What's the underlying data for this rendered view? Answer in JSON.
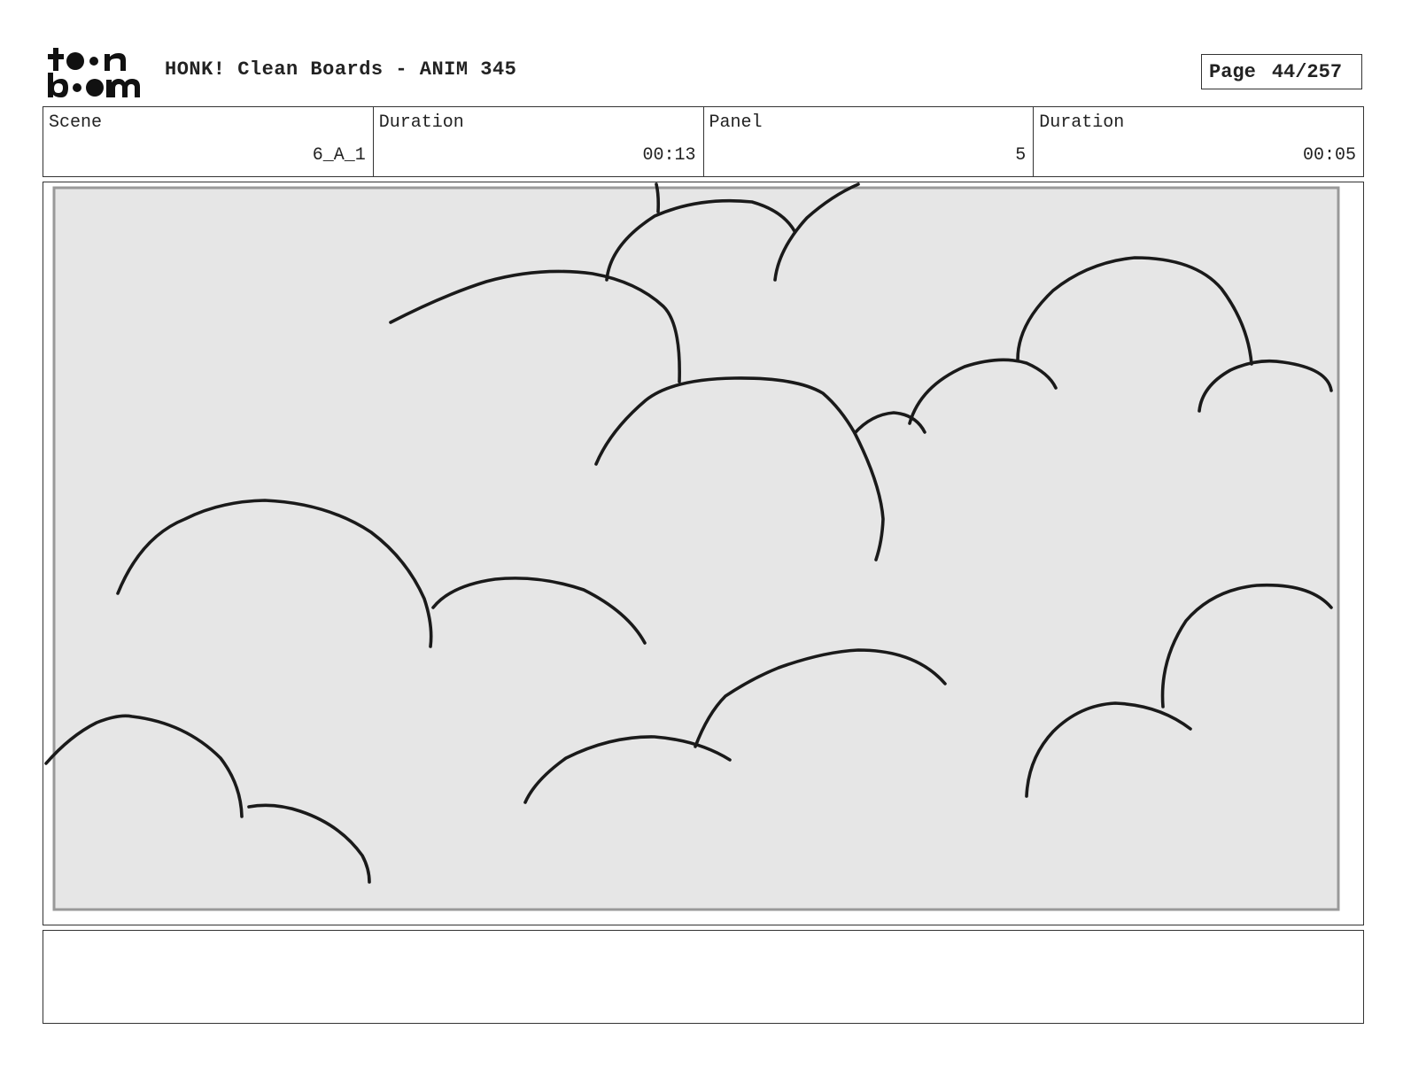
{
  "header": {
    "logo": {
      "line1": "toon",
      "line2": "boom",
      "icon": "toon-boom-logo"
    },
    "title": "HONK! Clean Boards - ANIM 345",
    "page_label": "Page",
    "page_value": "44/257"
  },
  "info": {
    "scene_label": "Scene",
    "scene_value": "6_A_1",
    "scene_duration_label": "Duration",
    "scene_duration_value": "00:13",
    "panel_label": "Panel",
    "panel_value": "5",
    "panel_duration_label": "Duration",
    "panel_duration_value": "00:05"
  },
  "panel": {
    "background_color": "#e6e6e6",
    "frame_color": "#999999",
    "line_color": "#1a1a1a",
    "icon": "cloud-sketch"
  },
  "notes": {
    "text": ""
  }
}
